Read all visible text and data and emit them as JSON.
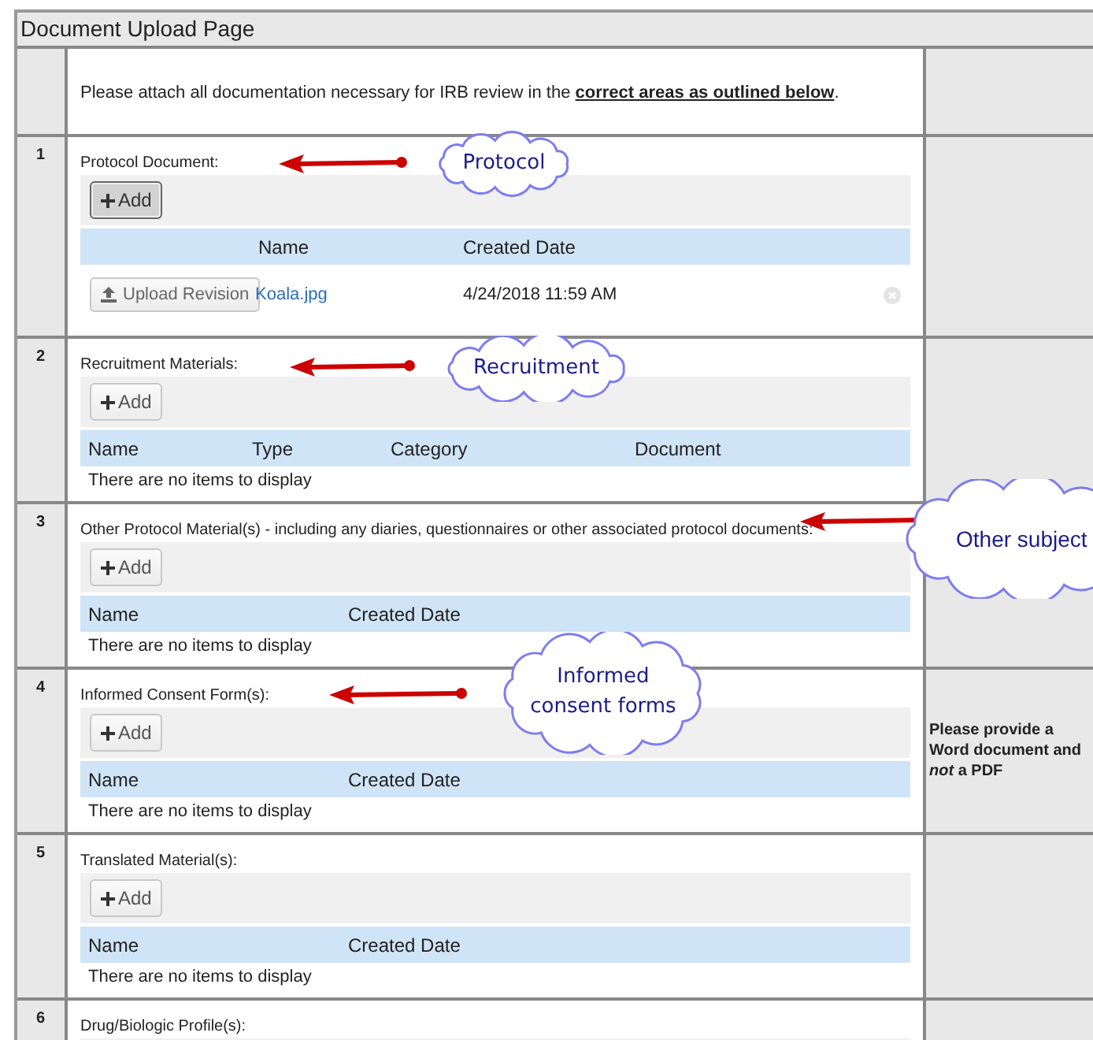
{
  "page": {
    "title": "Document Upload Page"
  },
  "intro": "Please attach all documentation necessary for IRB review in the **correct areas as outlined below**.",
  "sections": [
    {
      "number": "1",
      "label": "Protocol Document:",
      "add_button": {
        "label": "Add",
        "focused": true
      },
      "columns": [
        "Name",
        "Created Date"
      ],
      "files": [
        {
          "action": "Upload Revision",
          "name": "Koala.jpg",
          "created": "4/24/2018 11:59 AM"
        }
      ],
      "callout": "Protocol"
    },
    {
      "number": "2",
      "label": "Recruitment Materials:",
      "add_button": {
        "label": "Add",
        "focused": false
      },
      "columns": [
        "Name",
        "Type",
        "Category",
        "Document"
      ],
      "empty_message": "There are no items to display",
      "callout": "Recruitment"
    },
    {
      "number": "3",
      "label": "Other Protocol Material(s) - including any diaries, questionnaires or other associated protocol documents:",
      "add_button": {
        "label": "Add",
        "focused": false
      },
      "columns": [
        "Name",
        "Created Date"
      ],
      "empty_message": "There are no items to display",
      "callout": "Other subject"
    },
    {
      "number": "4",
      "label": "Informed Consent Form(s):",
      "add_button": {
        "label": "Add",
        "focused": false
      },
      "columns": [
        "Name",
        "Created Date"
      ],
      "empty_message": "There are no items to display",
      "callout": "Informed consent forms",
      "note": "Please provide a Word document and *not* a PDF"
    },
    {
      "number": "5",
      "label": "Translated Material(s):",
      "add_button": {
        "label": "Add",
        "focused": false
      },
      "columns": [
        "Name",
        "Created Date"
      ],
      "empty_message": "There are no items to display"
    },
    {
      "number": "6",
      "label": "Drug/Biologic Profile(s):"
    }
  ]
}
